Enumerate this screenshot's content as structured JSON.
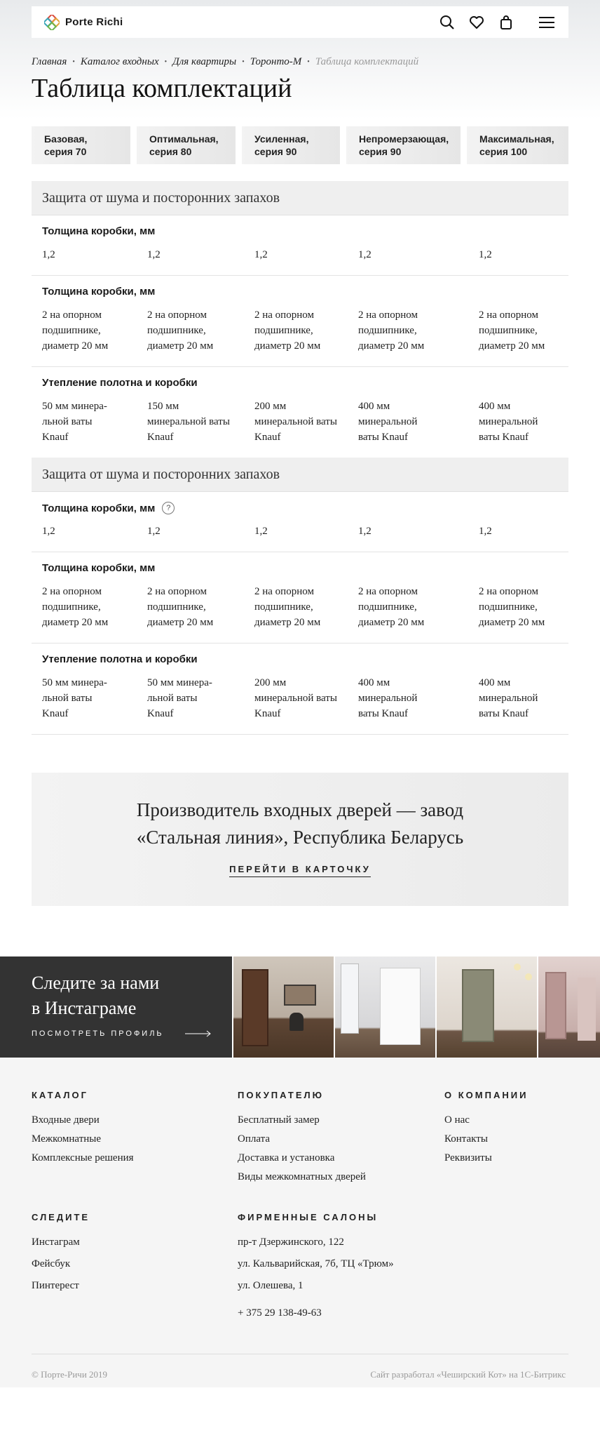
{
  "header": {
    "brand": "Porte Richi",
    "icons": [
      "search-icon",
      "heart-icon",
      "bag-icon",
      "menu-icon"
    ]
  },
  "breadcrumbs": [
    "Главная",
    "Каталог входных",
    "Для квартиры",
    "Торонто-М",
    "Таблица комплектаций"
  ],
  "page_title": "Таблица комплектаций",
  "tabs": [
    {
      "line1": "Базовая,",
      "line2": "серия 70"
    },
    {
      "line1": "Оптимальная,",
      "line2": "серия 80"
    },
    {
      "line1": "Усиленная,",
      "line2": "серия 90"
    },
    {
      "line1": "Непромерзающая,",
      "line2": "серия 90"
    },
    {
      "line1": "Максимальная,",
      "line2": "серия 100"
    }
  ],
  "sections": [
    {
      "title": "Защита от шума и посторонних запахов",
      "rows": [
        {
          "title": "Толщина коробки, мм",
          "cells": [
            "1,2",
            "1,2",
            "1,2",
            "1,2",
            "1,2"
          ]
        },
        {
          "title": "Толщина коробки, мм",
          "cells": [
            [
              "2 на опорном",
              "подшипнике,",
              "диаметр 20 мм"
            ],
            [
              "2 на опорном",
              "подшипнике,",
              "диаметр 20 мм"
            ],
            [
              "2 на опорном",
              "подшипнике,",
              "диаметр 20 мм"
            ],
            [
              "2 на опорном",
              "подшипнике,",
              "диаметр 20 мм"
            ],
            [
              "2 на опорном",
              "подшипнике,",
              "диаметр 20 мм"
            ]
          ]
        },
        {
          "title": "Утепление полотна и коробки",
          "cells": [
            [
              "50 мм минера-",
              "льной ваты",
              "Knauf"
            ],
            [
              "150 мм",
              "минеральной ваты",
              "Knauf"
            ],
            [
              "200 мм",
              "минеральной ваты",
              "Knauf"
            ],
            [
              "400 мм",
              "минеральной",
              "ваты Knauf"
            ],
            [
              "400 мм",
              "минеральной",
              "ваты Knauf"
            ]
          ]
        }
      ]
    },
    {
      "title": "Защита от шума и посторонних запахов",
      "rows": [
        {
          "title": "Толщина коробки, мм",
          "hint": "?",
          "cells": [
            "1,2",
            "1,2",
            "1,2",
            "1,2",
            "1,2"
          ]
        },
        {
          "title": "Толщина коробки, мм",
          "cells": [
            [
              "2 на опорном",
              "подшипнике,",
              "диаметр 20 мм"
            ],
            [
              "2 на опорном",
              "подшипнике,",
              "диаметр 20 мм"
            ],
            [
              "2 на опорном",
              "подшипнике,",
              "диаметр 20 мм"
            ],
            [
              "2 на опорном",
              "подшипнике,",
              "диаметр 20 мм"
            ],
            [
              "2 на опорном",
              "подшипнике,",
              "диаметр 20 мм"
            ]
          ]
        },
        {
          "title": "Утепление полотна и коробки",
          "cells": [
            [
              "50 мм минера-",
              "льной ваты",
              "Knauf"
            ],
            [
              "50 мм минера-",
              "льной ваты",
              "Knauf"
            ],
            [
              "200 мм",
              "минеральной ваты",
              "Knauf"
            ],
            [
              "400 мм",
              "минеральной",
              "ваты Knauf"
            ],
            [
              "400 мм",
              "минеральной",
              "ваты Knauf"
            ]
          ]
        }
      ]
    }
  ],
  "promo": {
    "line1": "Производитель входных дверей — завод",
    "line2": "«Стальная линия», Республика Беларусь",
    "link": "ПЕРЕЙТИ В КАРТОЧКУ"
  },
  "instagram": {
    "line1": "Следите за нами",
    "line2": "в Инстаграме",
    "link": "ПОСМОТРЕТЬ ПРОФИЛЬ"
  },
  "footer": {
    "catalog": {
      "title": "КАТАЛОГ",
      "links": [
        "Входные двери",
        "Межкомнатные",
        "Комплексные решения"
      ]
    },
    "buyer": {
      "title": "ПОКУПАТЕЛЮ",
      "links": [
        "Бесплатный замер",
        "Оплата",
        "Доставка и установка",
        "Виды межкомнатных дверей"
      ]
    },
    "company": {
      "title": "О КОМПАНИИ",
      "links": [
        "О нас",
        "Контакты",
        "Реквизиты"
      ]
    },
    "follow": {
      "title": "СЛЕДИТЕ",
      "links": [
        "Инстаграм",
        "Фейсбук",
        "Пинтерест"
      ]
    },
    "salons": {
      "title": "ФИРМЕННЫЕ САЛОНЫ",
      "links": [
        "пр-т Дзержинского, 122",
        "ул. Кальварийская, 7б, ТЦ «Трюм»",
        "ул. Олешева, 1"
      ],
      "phone": "+ 375 29 138-49-63"
    },
    "copyright": "© Порте-Ричи 2019",
    "developer": "Сайт разработал «Чеширский Кот» на 1С-Битрикс"
  }
}
